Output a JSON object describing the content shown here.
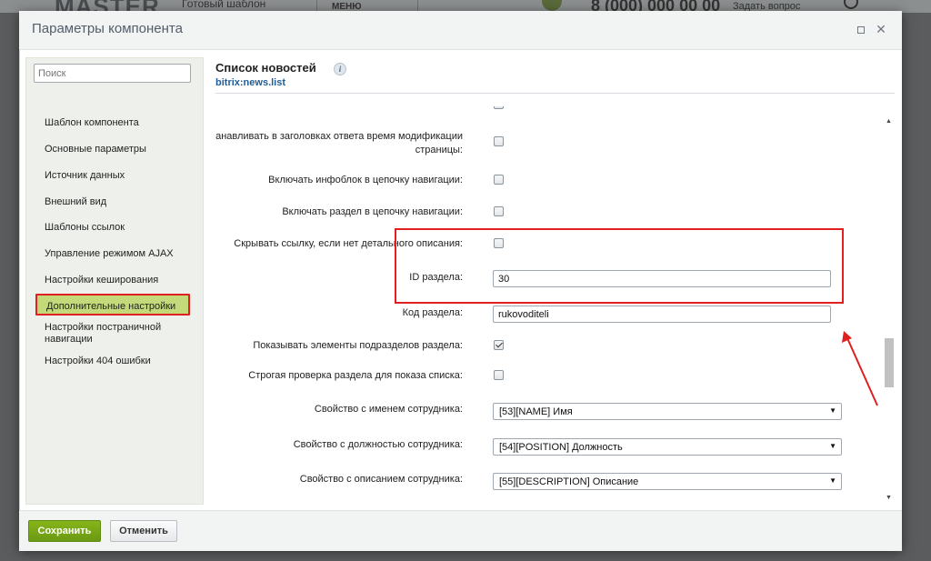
{
  "background": {
    "logo": "MASTER",
    "tagline": "Готовый шаблон",
    "menu": "МЕНЮ",
    "phone": "8 (000) 000 00 00",
    "ask": "Задать вопрос"
  },
  "dialog": {
    "title": "Параметры компонента"
  },
  "sidebar": {
    "search_placeholder": "Поиск",
    "items": [
      "Шаблон компонента",
      "Основные параметры",
      "Источник данных",
      "Внешний вид",
      "Шаблоны ссылок",
      "Управление режимом AJAX",
      "Настройки кеширования",
      "Дополнительные настройки",
      "Настройки постраничной навигации",
      "Настройки 404 ошибки"
    ],
    "active_index": 7
  },
  "main": {
    "title": "Список новостей",
    "info_symbol": "i",
    "component_code": "bitrix:news.list"
  },
  "params": {
    "last_modified_label": "Устанавливать в заголовках ответа время модификации страницы:",
    "last_modified_checked": false,
    "include_iblock_chain_label": "Включать инфоблок в цепочку навигации:",
    "include_iblock_chain_checked": false,
    "include_section_chain_label": "Включать раздел в цепочку навигации:",
    "include_section_chain_checked": false,
    "hide_link_label": "Скрывать ссылку, если нет детального описания:",
    "hide_link_checked": false,
    "section_id_label": "ID раздела:",
    "section_id_value": "30",
    "section_code_label": "Код раздела:",
    "section_code_value": "rukovoditeli",
    "show_subsections_label": "Показывать элементы подразделов раздела:",
    "show_subsections_checked": true,
    "strict_check_label": "Строгая проверка раздела для показа списка:",
    "strict_check_checked": false,
    "prop_name_label": "Свойство с именем сотрудника:",
    "prop_name_value": "[53][NAME] Имя",
    "prop_position_label": "Свойство с должностью сотрудника:",
    "prop_position_value": "[54][POSITION] Должность",
    "prop_description_label": "Свойство с описанием сотрудника:",
    "prop_description_value": "[55][DESCRIPTION] Описание"
  },
  "footer": {
    "save_label": "Сохранить",
    "cancel_label": "Отменить"
  },
  "colors": {
    "accent_green": "#86b419",
    "highlight_red": "#e02020",
    "link_blue": "#1e5d97"
  }
}
